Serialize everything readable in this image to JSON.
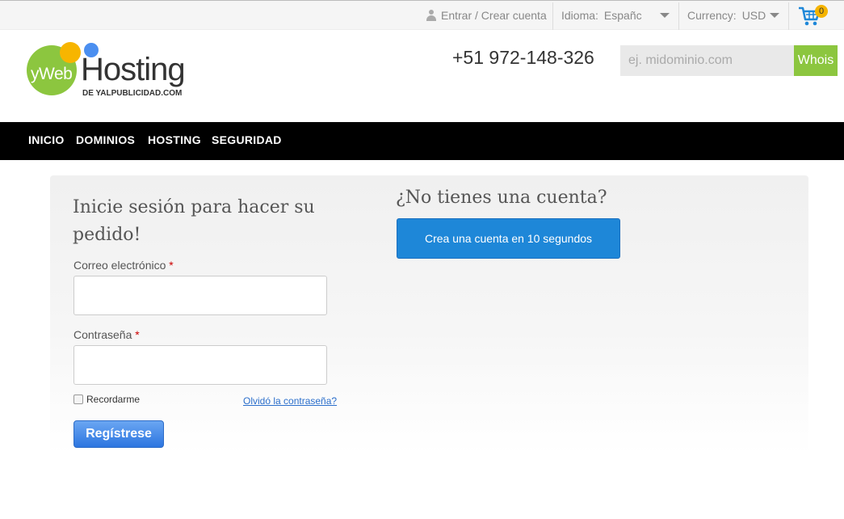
{
  "topbar": {
    "login_link": "Entrar / Crear cuenta",
    "language_label": "Idioma:",
    "language_value": "Españc",
    "currency_label": "Currency:",
    "currency_value": "USD",
    "cart_count": "0"
  },
  "header": {
    "logo_prefix": "yWeb",
    "logo_main": "Hosting",
    "logo_tagline": "DE YALPUBLICIDAD.COM",
    "phone": "+51 972-148-326",
    "domain_search_placeholder": "ej. midominio.com",
    "whois_label": "Whois"
  },
  "nav": {
    "items": [
      "INICIO",
      "DOMINIOS",
      "HOSTING",
      "SEGURIDAD"
    ]
  },
  "login": {
    "title": "Inicie sesión para hacer su pedido!",
    "email_label": "Correo electrónico",
    "password_label": "Contraseña",
    "required_mark": "*",
    "remember_label": "Recordarme",
    "forgot_link": "Olvidó la contraseña?",
    "submit_label": "Regístrese"
  },
  "signup": {
    "title": "¿No tienes una cuenta?",
    "create_button": "Crea una cuenta en 10 segundos"
  },
  "colors": {
    "brand_green": "#8cc63f",
    "brand_yellow": "#f7b500",
    "brand_blue": "#4b8ff0",
    "nav_bg": "#000000",
    "primary_button": "#1e87d8"
  },
  "icons": [
    "user-icon",
    "chevron-down-icon",
    "cart-icon"
  ]
}
